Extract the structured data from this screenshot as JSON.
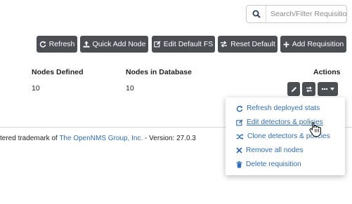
{
  "search": {
    "placeholder": "Search/Filter Requisition"
  },
  "toolbar": {
    "refresh": "Refresh",
    "quick_add_node": "Quick Add Node",
    "edit_default_fs": "Edit Default FS",
    "reset_default": "Reset Default",
    "add_requisition": "Add Requisition"
  },
  "table": {
    "headers": {
      "nodes_defined": "Nodes Defined",
      "nodes_in_database": "Nodes in Database",
      "actions": "Actions"
    },
    "row": {
      "nodes_defined": "10",
      "nodes_in_database": "10"
    }
  },
  "dropdown": {
    "items": [
      {
        "label": "Refresh deployed stats",
        "icon": "refresh-icon"
      },
      {
        "label": "Edit detectors & policies",
        "icon": "edit-icon"
      },
      {
        "label": "Clone detectors & policies",
        "icon": "shuffle-icon"
      },
      {
        "label": "Remove all nodes",
        "icon": "close-icon"
      },
      {
        "label": "Delete requisition",
        "icon": "trash-icon"
      }
    ]
  },
  "footer": {
    "prefix": "tered trademark of ",
    "link": "The OpenNMS Group, Inc.",
    "suffix": " - Version: 27.0.3"
  },
  "colors": {
    "button_bg": "#4b4f53",
    "link": "#2f6db5"
  }
}
